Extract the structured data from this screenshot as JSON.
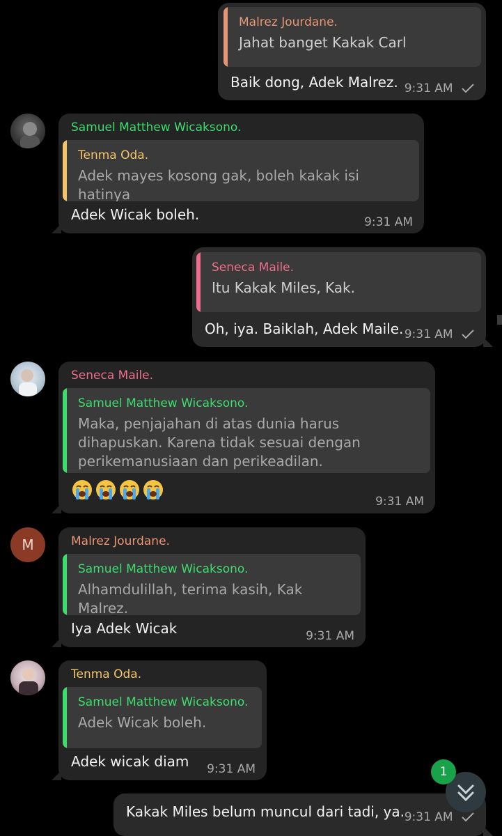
{
  "colors": {
    "orange": "#e79574",
    "yellow": "#f2c56b",
    "green": "#3ddc6d",
    "pink": "#ef6d8e",
    "ok_accent": "#2ed15b"
  },
  "messages": [
    {
      "quote_name": "Malrez  Jourdane.",
      "quote_text": "Jahat banget Kakak Carl",
      "text": "Baik dong, Adek Malrez.",
      "time": "9:31 AM"
    },
    {
      "sender": "Samuel Matthew Wicaksono.",
      "quote_name": "Tenma Oda.",
      "quote_text": "Adek mayes kosong gak, boleh kakak isi hatinya",
      "text": "Adek Wicak boleh.",
      "time": "9:31 AM"
    },
    {
      "quote_name": "Seneca Maile.",
      "quote_text": "Itu Kakak Miles, Kak.",
      "text": "Oh, iya. Baiklah, Adek Maile.",
      "time": "9:31 AM"
    },
    {
      "sender": "Seneca Maile.",
      "quote_name": "Samuel Matthew Wicaksono.",
      "quote_text": "Maka, penjajahan di atas dunia harus dihapuskan. Karena tidak sesuai dengan perikemanusiaan dan perikeadilan.",
      "emoji_count": 4,
      "time": "9:31 AM"
    },
    {
      "sender": "Malrez  Jourdane.",
      "avatar_letter": "M",
      "quote_name": "Samuel Matthew Wicaksono.",
      "quote_text": "Alhamdulillah, terima kasih, Kak Malrez.",
      "text": "Iya Adek Wicak",
      "time": "9:31 AM"
    },
    {
      "sender": "Tenma Oda.",
      "quote_name": "Samuel Matthew Wicaksono.",
      "quote_text": "Adek Wicak boleh.",
      "text": "Adek wicak diam",
      "time": "9:31 AM"
    },
    {
      "text": "Kakak Miles belum muncul dari tadi, ya.",
      "time": "9:31 AM"
    }
  ],
  "scroll_badge": "1",
  "icons": {
    "read_check": "check-icon",
    "scroll_down": "double-chevron-down-icon",
    "emoji": "loudly-crying-face-icon"
  }
}
